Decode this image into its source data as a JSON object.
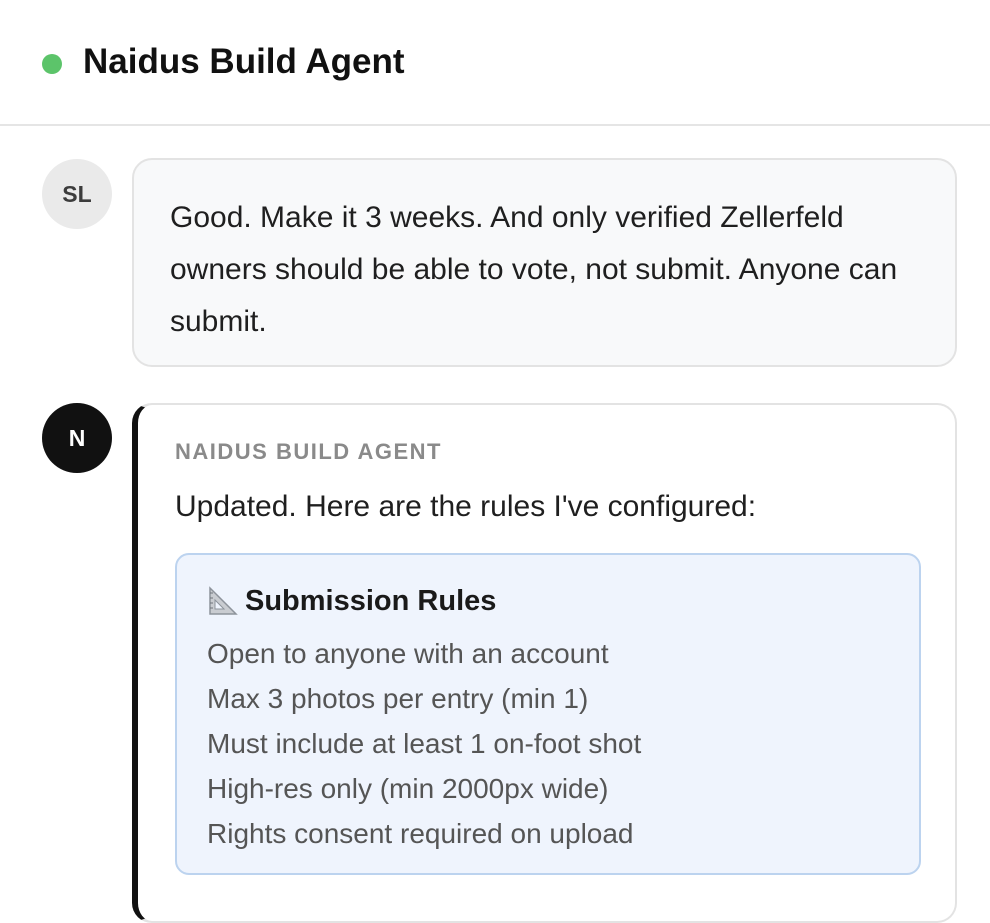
{
  "header": {
    "title": "Naidus Build Agent",
    "status_color": "#5cc46a"
  },
  "messages": [
    {
      "role": "user",
      "avatar_initials": "SL",
      "text": "Good. Make it 3 weeks. And only verified Zellerfeld owners should be able to vote, not submit. Anyone can submit."
    },
    {
      "role": "agent",
      "avatar_initials": "N",
      "sender_label": "NAIDUS BUILD AGENT",
      "text": "Updated. Here are the rules I've configured:",
      "card": {
        "icon": "triangular-ruler-icon",
        "title": "Submission Rules",
        "items": [
          "Open to anyone with an account",
          "Max 3 photos per entry (min 1)",
          "Must include at least 1 on-foot shot",
          "High-res only (min 2000px wide)",
          "Rights consent required on upload"
        ]
      }
    }
  ]
}
